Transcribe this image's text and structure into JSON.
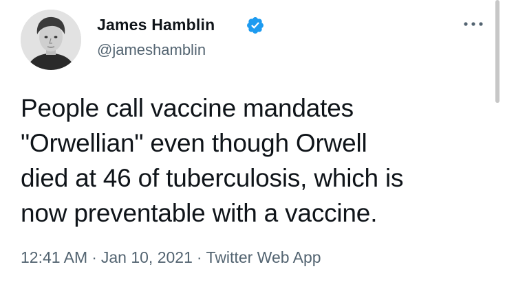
{
  "author": {
    "name": "James Hamblin",
    "handle": "@jameshamblin",
    "verified": true,
    "avatar_icon": "profile-photo"
  },
  "menu": {
    "icon": "more-horizontal-icon"
  },
  "tweet": {
    "lines": [
      "People call vaccine mandates",
      "\"Orwellian\" even though Orwell",
      "died at 46 of tuberculosis, which is",
      "now preventable with a vaccine."
    ]
  },
  "meta": {
    "time": "12:41 AM",
    "date": "Jan 10, 2021",
    "source": "Twitter Web App",
    "separator": "·"
  },
  "colors": {
    "text": "#0f1419",
    "secondary": "#536471",
    "verified_blue": "#1d9bf0",
    "background": "#ffffff"
  }
}
